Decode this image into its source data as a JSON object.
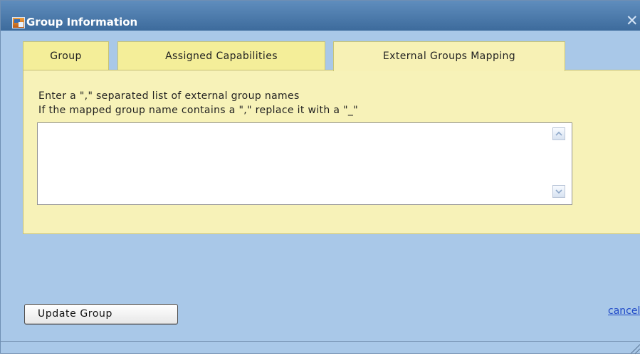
{
  "window": {
    "title": "Group Information",
    "icon_name": "group-window-icon",
    "close_glyph": "✕"
  },
  "tabs": [
    {
      "label": "Group"
    },
    {
      "label": "Assigned Capabilities"
    },
    {
      "label": "External Groups Mapping",
      "selected": true
    }
  ],
  "content": {
    "line1": "Enter a \",\" separated list of external group names",
    "line2": "If the mapped group name contains a \",\" replace it with a \"_\"",
    "textarea_value": ""
  },
  "actions": {
    "update_label": "Update Group",
    "cancel_label": "cancel"
  },
  "colors": {
    "titlebar": "#4d79a8",
    "dialog_background": "#a9c8e8",
    "tab_background": "#f4ee99",
    "content_background": "#f7f2b8",
    "link": "#1f49c8"
  }
}
